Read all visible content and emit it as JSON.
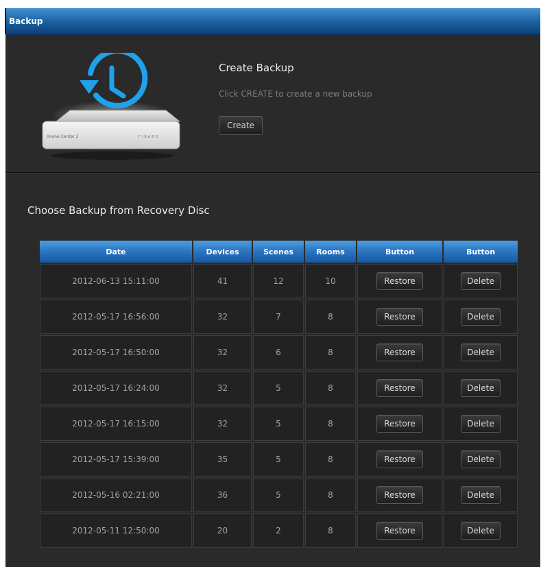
{
  "window": {
    "title": "Backup"
  },
  "create": {
    "title": "Create Backup",
    "hint": "Click CREATE to create a new backup",
    "button_label": "Create",
    "device_label": "Home Center 2",
    "device_brand": "FIBARO"
  },
  "restore_section": {
    "title": "Choose Backup from Recovery Disc"
  },
  "table": {
    "headers": [
      "Date",
      "Devices",
      "Scenes",
      "Rooms",
      "Button",
      "Button"
    ],
    "restore_label": "Restore",
    "delete_label": "Delete",
    "rows": [
      {
        "date": "2012-06-13 15:11:00",
        "devices": "41",
        "scenes": "12",
        "rooms": "10"
      },
      {
        "date": "2012-05-17 16:56:00",
        "devices": "32",
        "scenes": "7",
        "rooms": "8"
      },
      {
        "date": "2012-05-17 16:50:00",
        "devices": "32",
        "scenes": "6",
        "rooms": "8"
      },
      {
        "date": "2012-05-17 16:24:00",
        "devices": "32",
        "scenes": "5",
        "rooms": "8"
      },
      {
        "date": "2012-05-17 16:15:00",
        "devices": "32",
        "scenes": "5",
        "rooms": "8"
      },
      {
        "date": "2012-05-17 15:39:00",
        "devices": "35",
        "scenes": "5",
        "rooms": "8"
      },
      {
        "date": "2012-05-16 02:21:00",
        "devices": "36",
        "scenes": "5",
        "rooms": "8"
      },
      {
        "date": "2012-05-11 12:50:00",
        "devices": "20",
        "scenes": "2",
        "rooms": "8"
      }
    ]
  },
  "colors": {
    "panel_bg": "#2a2a2a",
    "header_blue": "#1b5f9f",
    "backup_icon": "#1ea2ec"
  },
  "icons": {
    "backup": "backup-clock-icon",
    "device": "home-center-device"
  }
}
